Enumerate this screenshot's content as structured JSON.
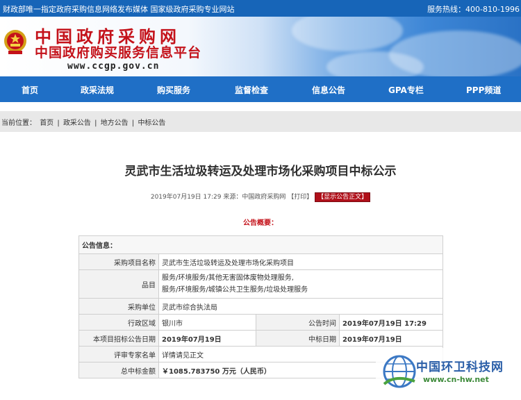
{
  "top_strip": {
    "left_text": "财政部唯一指定政府采购信息网络发布媒体 国家级政府采购专业网站",
    "right_text": "服务热线：400-810-1996"
  },
  "banner": {
    "title": "中国政府采购网",
    "subtitle": "中国政府购买服务信息平台",
    "url": "www.ccgp.gov.cn"
  },
  "nav": {
    "items": [
      "首页",
      "政采法规",
      "购买服务",
      "监督检查",
      "信息公告",
      "GPA专栏",
      "PPP频道"
    ]
  },
  "breadcrumb": {
    "prefix": "当前位置：",
    "items": [
      "首页",
      "政采公告",
      "地方公告",
      "中标公告"
    ],
    "separator": "|"
  },
  "article": {
    "title": "灵武市生活垃圾转运及处理市场化采购项目中标公示",
    "datetime": "2019年07月19日 17:29",
    "source_label": "来源：",
    "source": "中国政府采购网",
    "print_label": "【打印】",
    "show_label": "【显示公告正文】",
    "summary_heading": "公告概要："
  },
  "info_table": {
    "header": "公告信息：",
    "project_name_label": "采购项目名称",
    "project_name": "灵武市生活垃圾转运及处理市场化采购项目",
    "category_label": "品目",
    "category_line1": "服务/环境服务/其他无害固体废物处理服务,",
    "category_line2": "服务/环境服务/城镇公共卫生服务/垃圾处理服务",
    "purchaser_label": "采购单位",
    "purchaser": "灵武市综合执法局",
    "region_label": "行政区域",
    "region": "银川市",
    "announce_time_label": "公告时间",
    "announce_time": "2019年07月19日 17:29",
    "tender_date_label": "本项目招标公告日期",
    "tender_date": "2019年07月19日",
    "award_date_label": "中标日期",
    "award_date": "2019年07月19日",
    "expert_label": "评审专家名单",
    "expert": "详情请见正文",
    "amount_label": "总中标金额",
    "amount": "￥1085.783750 万元（人民币）"
  },
  "watermark": {
    "name": "中国环卫科技网",
    "url": "www.cn-hw.net"
  },
  "colors": {
    "brand_red": "#c4121a",
    "nav_blue": "#1f6fc6",
    "top_blue": "#1765b8"
  }
}
